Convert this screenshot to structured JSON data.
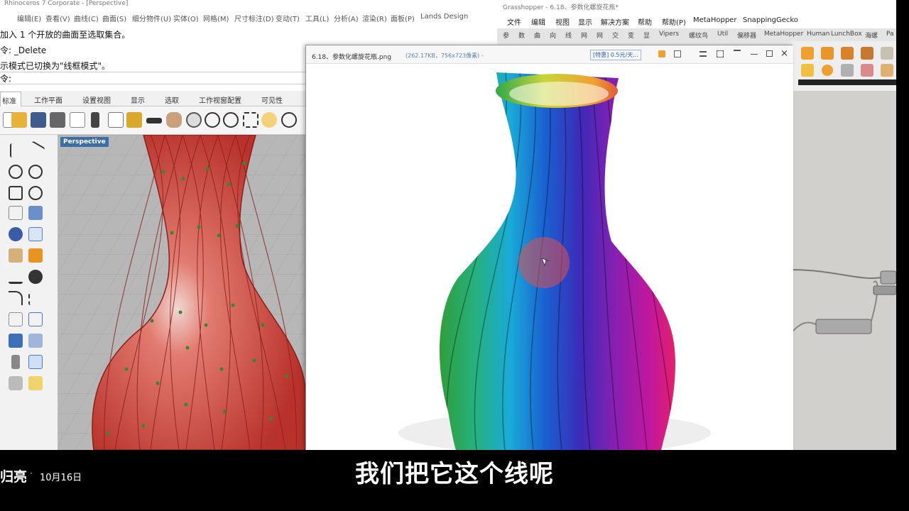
{
  "rhino": {
    "title": "Rhinoceros 7 Corporate - [Perspective]",
    "menu": [
      "编辑(E)",
      "查看(V)",
      "曲线(C)",
      "曲面(S)",
      "细分物件(U)",
      "实体(O)",
      "网格(M)",
      "尺寸标注(D)",
      "变动(T)",
      "工具(L)",
      "分析(A)",
      "渲染(R)",
      "面板(P)",
      "Lands Design"
    ],
    "command_lines": [
      "加入 1 个开放的曲面至选取集合。",
      "令: _Delete",
      "示模式已切换为\"线框模式\"。"
    ],
    "command_prompt": "令:",
    "tabs": [
      "标准",
      "工作平面",
      "设置视图",
      "显示",
      "选取",
      "工作视窗配置",
      "可见性"
    ],
    "viewport_label": "Perspective"
  },
  "grasshopper": {
    "title": "Grasshopper - 6.18、参数化螺旋花瓶*",
    "menu": [
      "文件",
      "编辑",
      "视图",
      "显示",
      "解决方案",
      "帮助",
      "帮助(P)",
      "MetaHopper",
      "SnappingGecko"
    ],
    "tabs": [
      "参",
      "数",
      "曲",
      "向",
      "线",
      "网",
      "网",
      "交",
      "变",
      "显",
      "Vipers",
      "螺纹鸟",
      "Util",
      "偏移器",
      "MetaHopper",
      "Human",
      "LunchBox",
      "海螺",
      "Pa"
    ]
  },
  "viewer": {
    "title": "6.18、参数化螺旋花瓶.png",
    "file_info": "(262.17KB，756x723像素) -",
    "ad": "[特惠] 0.5元/天..."
  },
  "video": {
    "author": "归亮",
    "separator": "·",
    "date": "10月16日",
    "caption": "我们把它这个线呢"
  },
  "colors": {
    "vase_red": "#c9352e",
    "viewport_bg": "#b7b7b7",
    "subtitle_bg": "#000000",
    "caption_text": "#ffffff"
  }
}
